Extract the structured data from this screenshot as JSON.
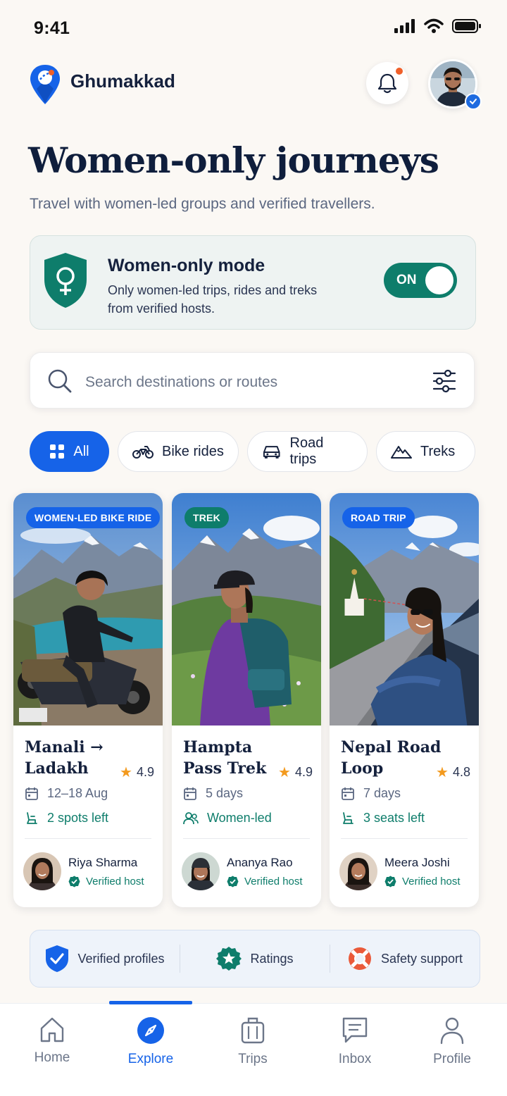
{
  "status_bar": {
    "time": "9:41"
  },
  "header": {
    "app_name": "Ghumakkad"
  },
  "hero": {
    "title": "Women-only journeys",
    "subtitle": "Travel with women-led groups and verified travellers."
  },
  "women_mode": {
    "title": "Women-only mode",
    "description": "Only women-led trips, rides and treks from verified hosts.",
    "toggle_label": "ON",
    "enabled": true
  },
  "search": {
    "placeholder": "Search destinations or routes"
  },
  "categories": [
    {
      "label": "All",
      "icon": "grid-icon",
      "active": true
    },
    {
      "label": "Bike rides",
      "icon": "motorbike-icon",
      "active": false
    },
    {
      "label": "Road trips",
      "icon": "car-icon",
      "active": false
    },
    {
      "label": "Treks",
      "icon": "mountain-icon",
      "active": false
    }
  ],
  "trips": [
    {
      "tag": "WOMEN-LED BIKE RIDE",
      "title": "Manali → Ladakh",
      "rating": "4.9",
      "dates": "12–18 Aug",
      "availability": "2 spots left",
      "host": "Riya Sharma",
      "host_status": "Verified host",
      "tag_color": "#1663e8"
    },
    {
      "tag": "TREK",
      "title": "Hampta Pass Trek",
      "rating": "4.9",
      "dates": "5 days",
      "availability": "Women-led",
      "host": "Ananya Rao",
      "host_status": "Verified host",
      "tag_color": "#0e7d6b"
    },
    {
      "tag": "ROAD TRIP",
      "title": "Nepal Road Loop",
      "rating": "4.8",
      "dates": "7 days",
      "availability": "3 seats left",
      "host": "Meera Joshi",
      "host_status": "Verified host",
      "tag_color": "#1663e8"
    }
  ],
  "trust": [
    {
      "label": "Verified profiles",
      "icon": "shield-check-icon"
    },
    {
      "label": "Ratings",
      "icon": "star-badge-icon"
    },
    {
      "label": "Safety support",
      "icon": "lifebuoy-icon"
    }
  ],
  "nav": [
    {
      "label": "Home",
      "icon": "home-icon",
      "active": false
    },
    {
      "label": "Explore",
      "icon": "compass-icon",
      "active": true
    },
    {
      "label": "Trips",
      "icon": "suitcase-icon",
      "active": false
    },
    {
      "label": "Inbox",
      "icon": "message-icon",
      "active": false
    },
    {
      "label": "Profile",
      "icon": "person-icon",
      "active": false
    }
  ],
  "colors": {
    "primary": "#1663e8",
    "teal": "#0e7d6b",
    "star": "#f39a1e",
    "background": "#fbf8f4"
  }
}
